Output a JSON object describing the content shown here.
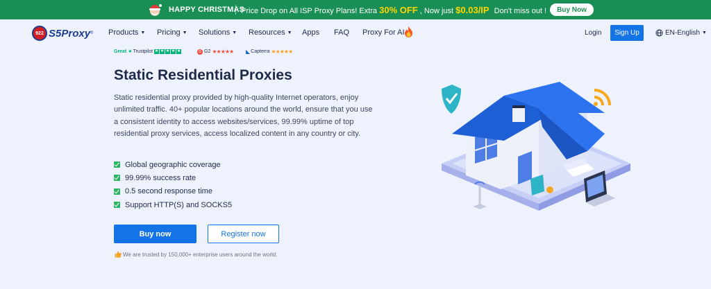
{
  "promo": {
    "holiday": "HAPPY CHRISTMAS",
    "message_pre": "Price Drop on All ISP Proxy Plans!  Extra",
    "discount": "30% OFF",
    "message_mid": ", Now just",
    "price": "$0.03/IP",
    "message_post": "Don't miss out !",
    "button": "Buy Now"
  },
  "nav": {
    "logo_badge": "922",
    "logo_text": "S5Proxy",
    "logo_reg": "®",
    "items": [
      {
        "label": "Products",
        "dropdown": true
      },
      {
        "label": "Pricing",
        "dropdown": true
      },
      {
        "label": "Solutions",
        "dropdown": true
      },
      {
        "label": "Resources",
        "dropdown": true
      },
      {
        "label": "Apps",
        "dropdown": false
      },
      {
        "label": "FAQ",
        "dropdown": false
      },
      {
        "label": "Proxy For AI",
        "dropdown": false
      }
    ],
    "login": "Login",
    "signup": "Sign Up",
    "language": "EN-English"
  },
  "ratings": {
    "trustpilot": {
      "label": "Great",
      "brand": "Trustpilot"
    },
    "g2": {
      "brand": "G2"
    },
    "capterra": {
      "brand": "Capterra"
    }
  },
  "hero": {
    "title": "Static Residential Proxies",
    "description": "Static residential proxy provided by high-quality Internet operators, enjoy unlimited traffic. 40+ popular locations around the world, ensure that you use a consistent identity to access websites/services, 99.99% uptime of top residential proxy services, access localized content in any country or city.",
    "features": [
      "Global geographic coverage",
      "99.99% success rate",
      "0.5 second response time",
      "Support HTTP(S) and SOCKS5"
    ],
    "buy_button": "Buy now",
    "register_button": "Register now",
    "trust_text": "We are trusted by 150,000+ enterprise users around the world."
  },
  "colors": {
    "promo_bg": "#1a8f55",
    "highlight": "#ffd500",
    "primary": "#1473e6",
    "page_bg": "#eef2fc",
    "check": "#2db464"
  },
  "icons": [
    "santa-icon",
    "caret-down-icon",
    "fire-icon",
    "globe-icon",
    "trustpilot-star-icon",
    "g2-icon",
    "capterra-icon",
    "check-icon",
    "thumbs-up-icon",
    "house-illustration"
  ]
}
